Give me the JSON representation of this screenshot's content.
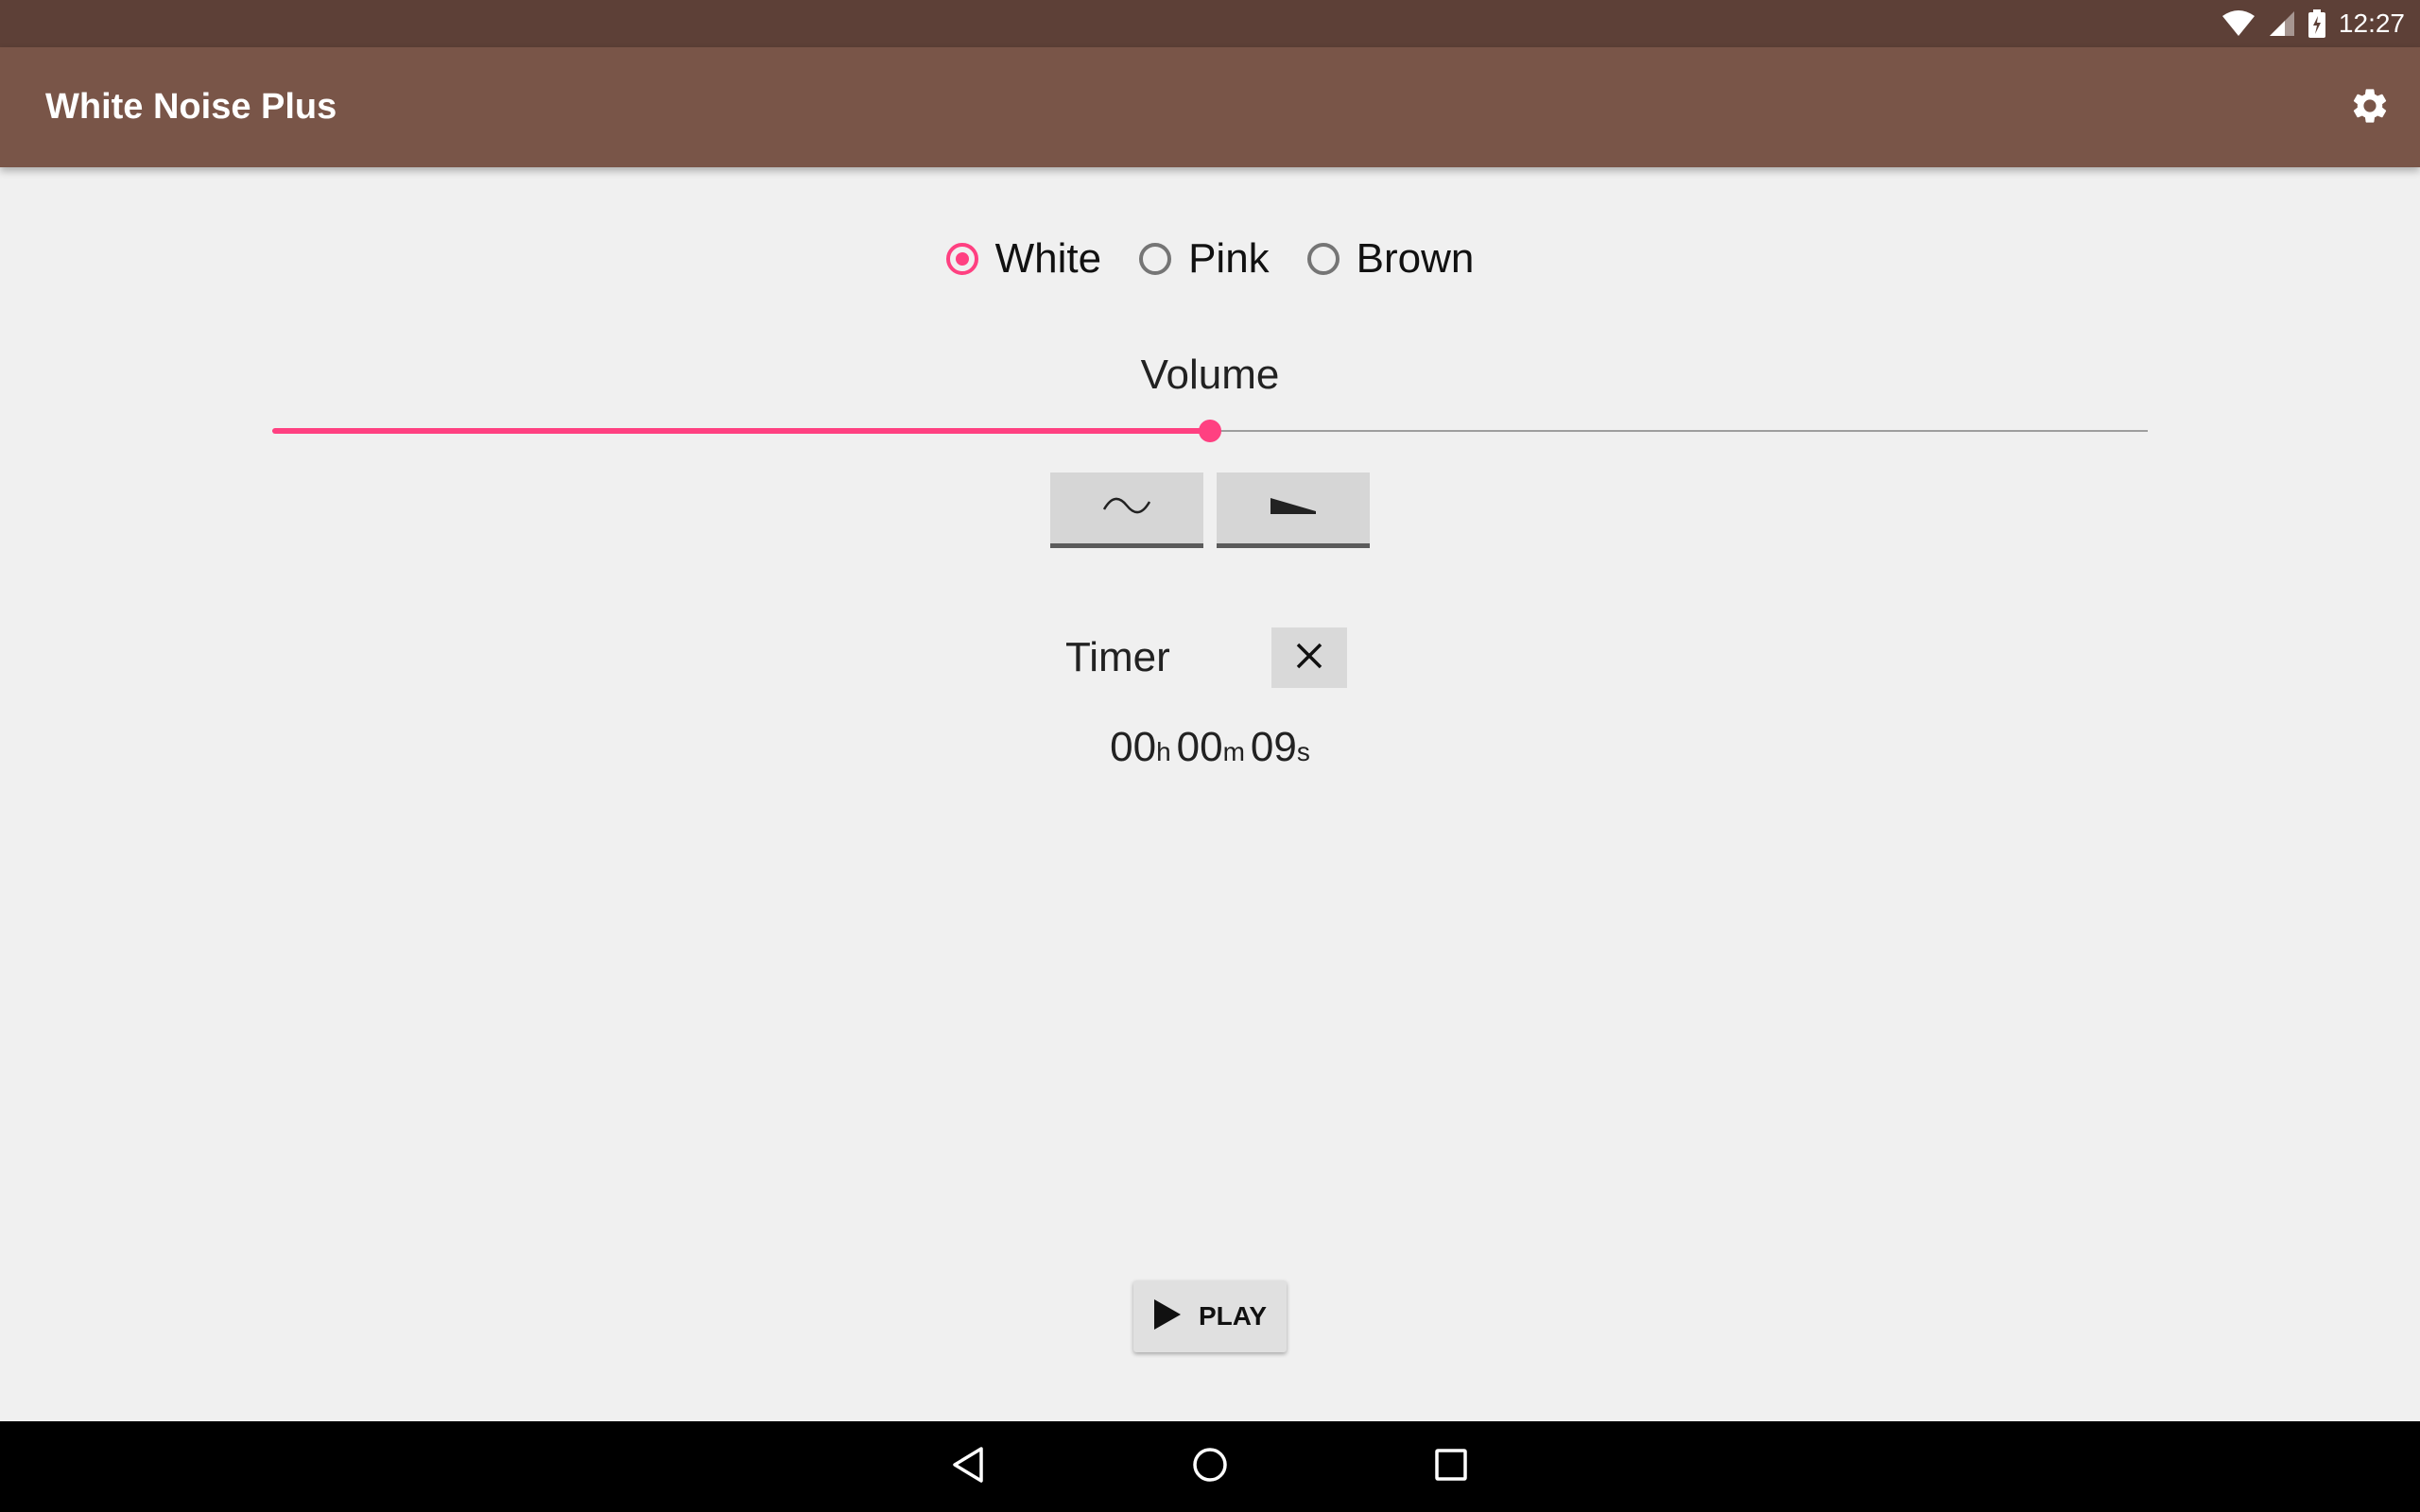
{
  "status_bar": {
    "time": "12:27",
    "icons": [
      "wifi-icon",
      "cell-signal-icon",
      "battery-charging-icon"
    ]
  },
  "app_bar": {
    "title": "White Noise Plus",
    "settings_icon": "gear-icon"
  },
  "noise_type": {
    "options": [
      {
        "label": "White",
        "checked": true
      },
      {
        "label": "Pink",
        "checked": false
      },
      {
        "label": "Brown",
        "checked": false
      }
    ]
  },
  "volume": {
    "label": "Volume",
    "level_fraction": 0.5
  },
  "shape_buttons": [
    {
      "icon": "sine-wave-icon"
    },
    {
      "icon": "ramp-icon"
    }
  ],
  "timer": {
    "label": "Timer",
    "clear_icon": "close-icon",
    "hours": "00",
    "hours_unit": "h",
    "minutes": "00",
    "minutes_unit": "m",
    "seconds": "09",
    "seconds_unit": "s"
  },
  "play": {
    "label": "PLAY",
    "icon": "play-icon"
  },
  "nav_bar": {
    "icons": [
      "back-icon",
      "home-icon",
      "recents-icon"
    ]
  },
  "colors": {
    "status_bar": "#5d4037",
    "app_bar": "#795548",
    "accent": "#ff4081",
    "background": "#f0f0f0"
  }
}
